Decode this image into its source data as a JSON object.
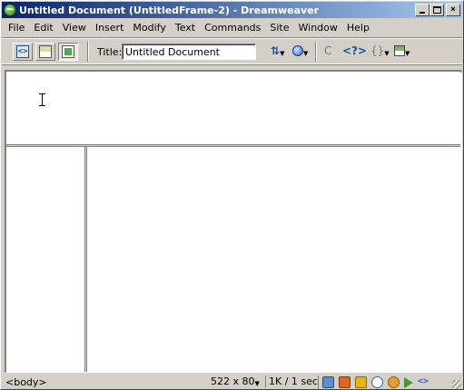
{
  "window": {
    "title": "Untitled Document (UntitledFrame-2) - Dreamweaver"
  },
  "menubar": {
    "items": [
      {
        "label": "File"
      },
      {
        "label": "Edit"
      },
      {
        "label": "View"
      },
      {
        "label": "Insert"
      },
      {
        "label": "Modify"
      },
      {
        "label": "Text"
      },
      {
        "label": "Commands"
      },
      {
        "label": "Site"
      },
      {
        "label": "Window"
      },
      {
        "label": "Help"
      }
    ]
  },
  "toolbar": {
    "title_label": "Title:",
    "title_value": "Untitled Document",
    "buttons": [
      "code-view-icon",
      "split-view-icon",
      "design-view-icon",
      "file-management-icon",
      "preview-browser-icon",
      "refresh-icon",
      "reference-icon",
      "code-nav-icon",
      "view-options-icon"
    ]
  },
  "statusbar": {
    "tag_selector": "<body>",
    "window_size": "522 x 80",
    "download_stats": "1K / 1 sec",
    "launcher_icons": [
      "site-icon",
      "assets-icon",
      "html-styles-icon",
      "behaviors-icon",
      "history-icon",
      "play-icon",
      "code-inspector-icon"
    ]
  }
}
